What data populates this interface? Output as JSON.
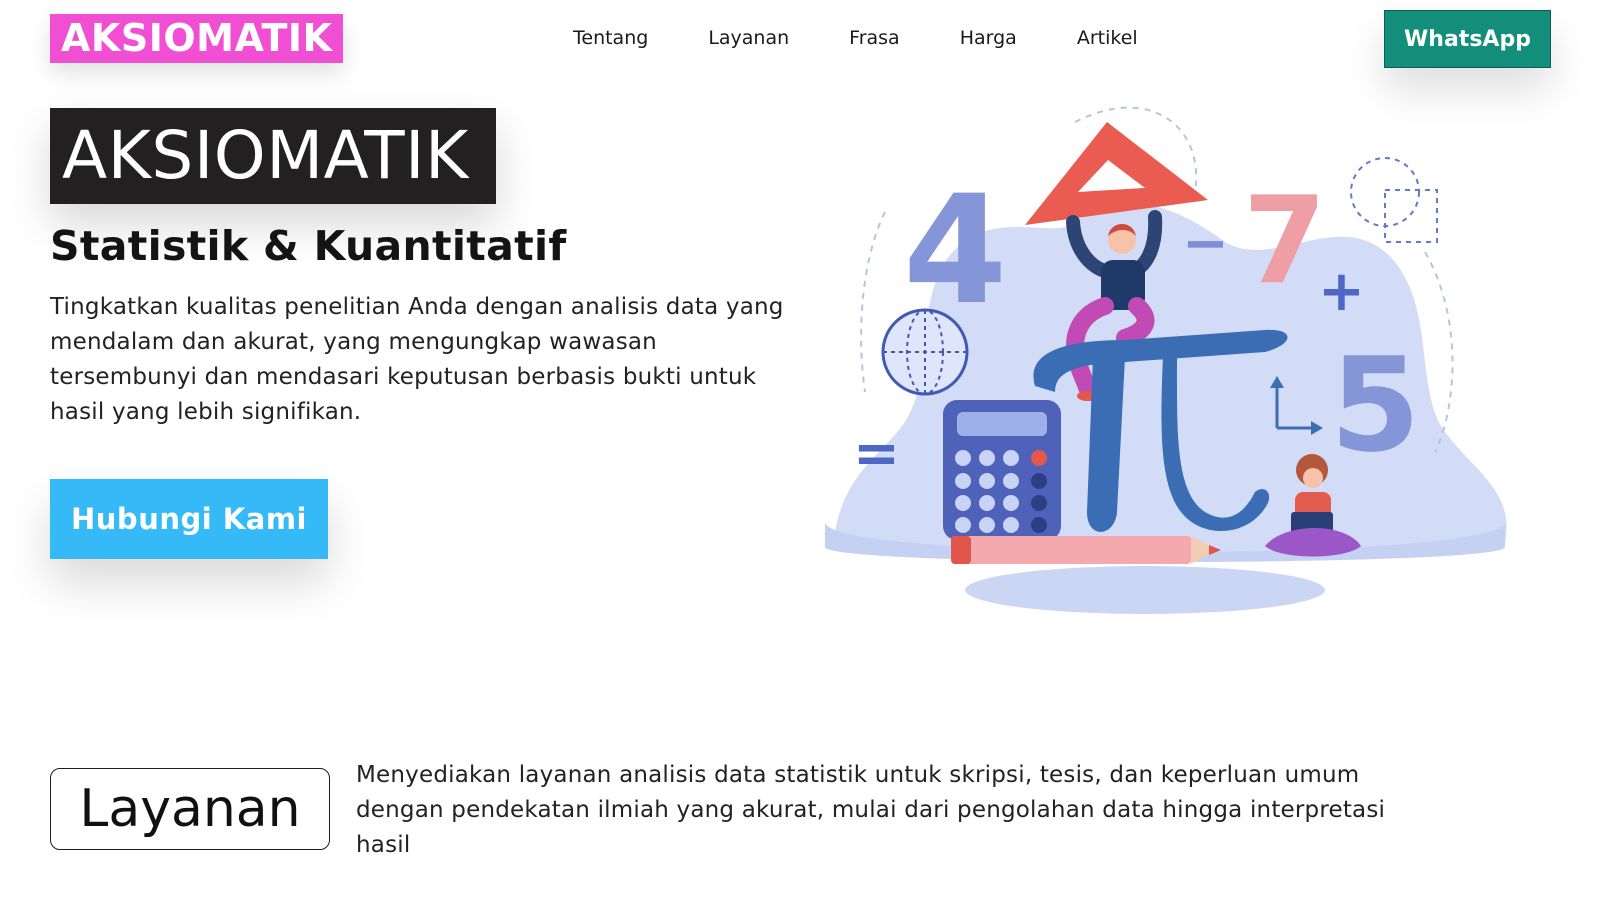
{
  "header": {
    "logo": "AKSIOMATIK",
    "nav": [
      "Tentang",
      "Layanan",
      "Frasa",
      "Harga",
      "Artikel"
    ],
    "whatsapp_label": "WhatsApp"
  },
  "hero": {
    "title": "AKSIOMATIK",
    "subtitle": "Statistik & Kuantitatif",
    "description": "Tingkatkan kualitas penelitian Anda dengan analisis data yang mendalam dan akurat, yang mengungkap wawasan tersembunyi dan mendasari keputusan berbasis bukti untuk hasil yang lebih signifikan.",
    "cta_label": "Hubungi Kami",
    "illustration": {
      "digits": [
        "4",
        "7",
        "5"
      ],
      "symbols": [
        "−",
        "+",
        "="
      ],
      "icons": [
        "triangle-ruler-icon",
        "pi-icon",
        "calculator-icon",
        "pencil-icon",
        "globe-icon",
        "axes-icon"
      ]
    }
  },
  "services": {
    "label": "Layanan",
    "description": "Menyediakan layanan analisis data statistik untuk skripsi, tesis, dan keperluan umum dengan pendekatan ilmiah yang akurat, mulai dari pengolahan data hingga interpretasi hasil"
  },
  "colors": {
    "logo_bg": "#f04fd3",
    "whatsapp_bg": "#138e7b",
    "title_bg": "#222021",
    "cta_bg": "#36b9f7"
  }
}
